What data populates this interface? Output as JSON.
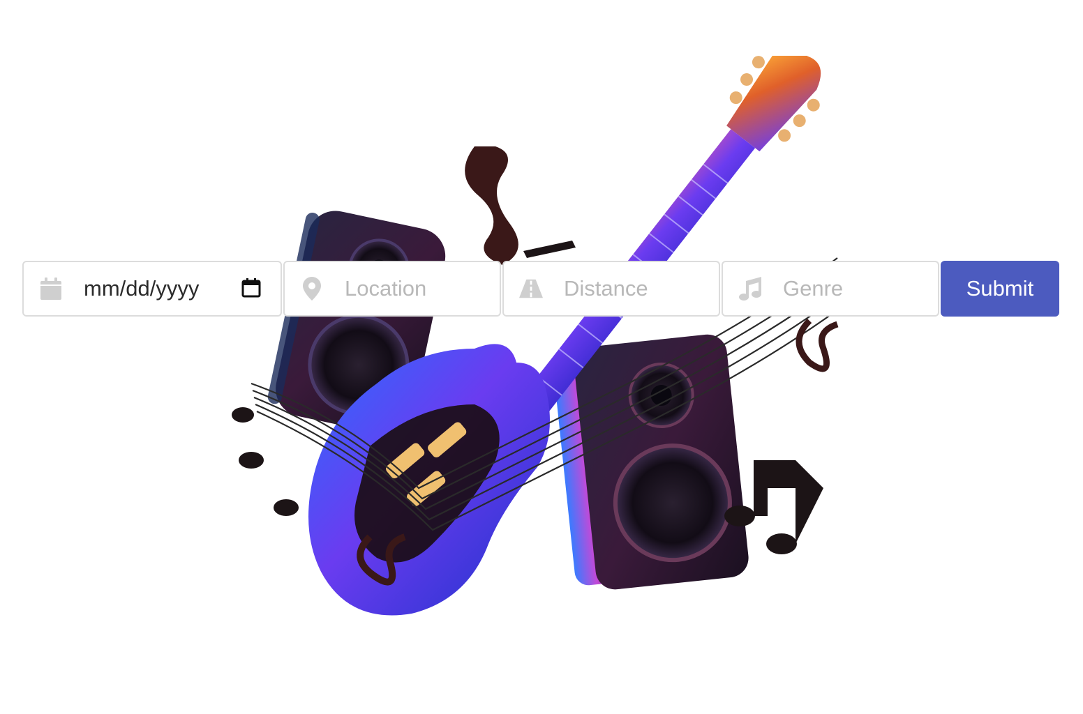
{
  "hero": {
    "image": "guitar-speakers-music-notes-illustration"
  },
  "search": {
    "date": {
      "value": "mm/dd/yyyy",
      "icon": "calendar-icon",
      "picker_icon": "calendar-picker-icon"
    },
    "location": {
      "placeholder": "Location",
      "icon": "map-pin-icon"
    },
    "distance": {
      "placeholder": "Distance",
      "icon": "road-icon"
    },
    "genre": {
      "placeholder": "Genre",
      "icon": "music-note-icon"
    },
    "submit_label": "Submit"
  },
  "colors": {
    "button": "#4c5bbf",
    "icon": "#cfcfcf",
    "border": "#dcdcdc",
    "placeholder": "#b8b8b8"
  }
}
